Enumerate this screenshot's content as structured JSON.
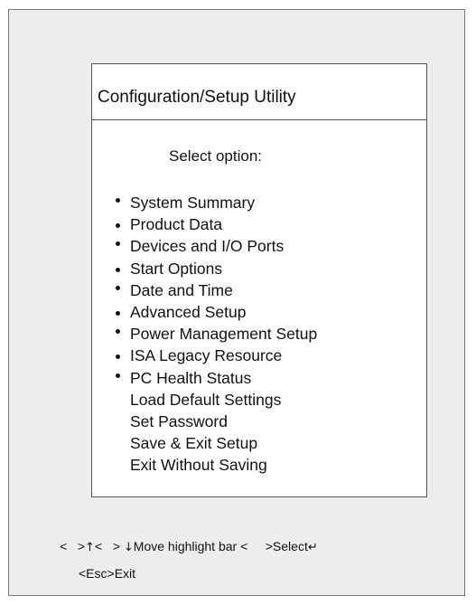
{
  "panel": {
    "title": "Configuration/Setup Utility",
    "select_label": "Select  option:",
    "menu_items": [
      {
        "label": "System Summary",
        "bullet": true
      },
      {
        "label": "Product Data",
        "bullet": true
      },
      {
        "label": "Devices and I/O Ports",
        "bullet": true
      },
      {
        "label": "Start Options",
        "bullet": true
      },
      {
        "label": "Date and Time",
        "bullet": true
      },
      {
        "label": "Advanced Setup",
        "bullet": true
      },
      {
        "label": "Power Management Setup",
        "bullet": true
      },
      {
        "label": "ISA Legacy Resource",
        "bullet": true
      },
      {
        "label": "PC Health Status",
        "bullet": true
      },
      {
        "label": "Load Default Settings",
        "bullet": false
      },
      {
        "label": "Set Password",
        "bullet": false
      },
      {
        "label": "Save & Exit Setup",
        "bullet": false
      },
      {
        "label": "Exit Without Saving",
        "bullet": false
      }
    ]
  },
  "hints": {
    "move_open": "<",
    "move_close": ">",
    "up_arrow_icon": "arrow-up-icon",
    "move_open2": "<",
    "move_close2": ">",
    "down_arrow_icon": "arrow-down-icon",
    "move_text": "Move highlight bar",
    "select_open": "<",
    "select_close": ">",
    "enter_icon": "enter-key-icon",
    "select_text": "Select",
    "esc_line": "<Esc>Exit"
  }
}
